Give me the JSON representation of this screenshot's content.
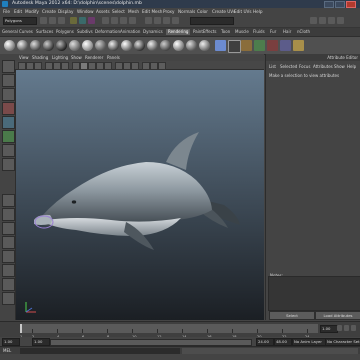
{
  "window": {
    "title": "Autodesk Maya 2012 x64: D:\\dolphin\\scenes\\dolphin.mb",
    "min_icon": "minimize-icon",
    "max_icon": "maximize-icon",
    "close_icon": "close-icon"
  },
  "menubar": {
    "items": [
      "File",
      "Edit",
      "Modify",
      "Create",
      "Display",
      "Window",
      "Assets",
      "Select",
      "Mesh",
      "Edit Mesh",
      "Proxy",
      "Normals",
      "Color",
      "Create UVs",
      "Edit UVs",
      "Help"
    ]
  },
  "statusline": {
    "mode": "Polygons"
  },
  "shelf": {
    "tabs": [
      "General",
      "Curves",
      "Surfaces",
      "Polygons",
      "Subdivs",
      "Deformation",
      "Animation",
      "Dynamics",
      "Rendering",
      "PaintEffects",
      "Toon",
      "Muscle",
      "Fluids",
      "Fur",
      "Hair",
      "nCloth"
    ],
    "active_tab": "Rendering"
  },
  "viewport": {
    "menu": [
      "View",
      "Shading",
      "Lighting",
      "Show",
      "Renderer",
      "Panels"
    ],
    "axis": {
      "x": "x",
      "y": "y"
    }
  },
  "attribute_editor": {
    "title": "Attribute Editor",
    "menu": [
      "List",
      "Selected",
      "Focus",
      "Attributes",
      "Show",
      "Help"
    ],
    "message": "Make a selection to view attributes",
    "notes_label": "Notes:",
    "select_button": "Select",
    "load_button": "Load Attributes"
  },
  "timeline": {
    "ticks": [
      "1",
      "2",
      "4",
      "6",
      "8",
      "10",
      "12",
      "14",
      "16",
      "18",
      "20",
      "22",
      "24"
    ],
    "current_frame": "1.00"
  },
  "range": {
    "start": "1.00",
    "start2": "1.00",
    "end": "24.00",
    "end2": "48.00",
    "anim_layer": "No Anim Layer",
    "character": "No Character Set"
  },
  "cmdline": {
    "label": "MEL"
  }
}
